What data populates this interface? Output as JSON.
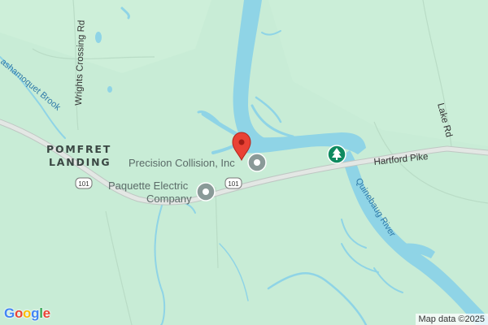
{
  "map": {
    "places": [
      {
        "line1": "POMFRET",
        "line2": "LANDING"
      }
    ],
    "pois": [
      {
        "name_line1": "Precision Collision, Inc",
        "name_line2": ""
      },
      {
        "name_line1": "Paquette Electric",
        "name_line2": "Company"
      }
    ],
    "roads": {
      "hartford_pike": "Hartford Pike",
      "lake_rd": "Lake Rd",
      "wrights_crossing": "Wrights Crossing Rd"
    },
    "route_shield": "101",
    "water": {
      "quinebaug": "Quinebaug River",
      "mashamoquet": "ashamoquet Brook"
    },
    "colors": {
      "land": "#c8ecd6",
      "water": "#8fd4e6",
      "road": "#d6dcd8",
      "pin": "#e94235",
      "park": "#0f8a5f",
      "poi_marker": "#8a9a98"
    },
    "icons": {
      "pin": "map-pin-icon",
      "park": "tree-icon",
      "poi": "poi-circle-icon"
    }
  },
  "footer": {
    "logo_letters": [
      "G",
      "o",
      "o",
      "g",
      "l",
      "e"
    ],
    "attribution": "Map data ©2025"
  }
}
